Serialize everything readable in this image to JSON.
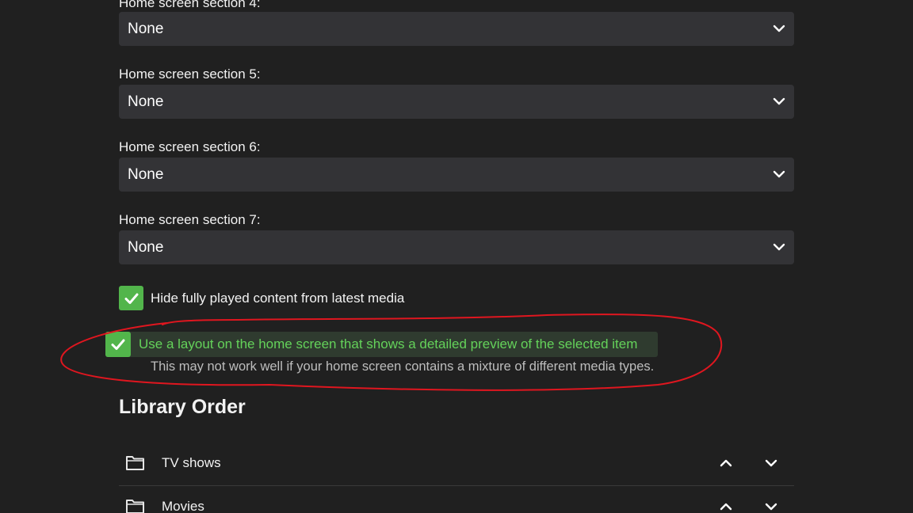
{
  "sections": [
    {
      "label": "Home screen section 4:",
      "value": "None"
    },
    {
      "label": "Home screen section 5:",
      "value": "None"
    },
    {
      "label": "Home screen section 6:",
      "value": "None"
    },
    {
      "label": "Home screen section 7:",
      "value": "None"
    }
  ],
  "options": {
    "hide_played": {
      "label": "Hide fully played content from latest media",
      "checked": true
    },
    "detailed_layout": {
      "label": "Use a layout on the home screen that shows a detailed preview of the selected item",
      "helper": "This may not work well if your home screen contains a mixture of different media types.",
      "checked": true
    }
  },
  "library": {
    "title": "Library Order",
    "items": [
      {
        "name": "TV shows"
      },
      {
        "name": "Movies"
      }
    ]
  },
  "colors": {
    "accent": "#52b54b",
    "highlight_text": "#64d25a",
    "annotation": "#e0161f"
  }
}
